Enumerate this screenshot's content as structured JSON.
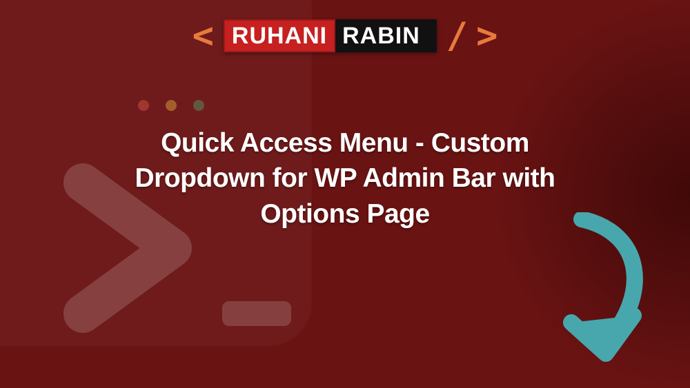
{
  "logo": {
    "first": "RUHANI",
    "second": "RABIN"
  },
  "brackets": {
    "open": "<",
    "slash": "/",
    "close": ">"
  },
  "title": "Quick Access Menu - Custom Dropdown for WP Admin Bar with Options Page",
  "colors": {
    "accent_orange": "#E77A3E",
    "accent_teal": "#48A7AD",
    "brand_red": "#C62020",
    "background": "#6A1313"
  }
}
